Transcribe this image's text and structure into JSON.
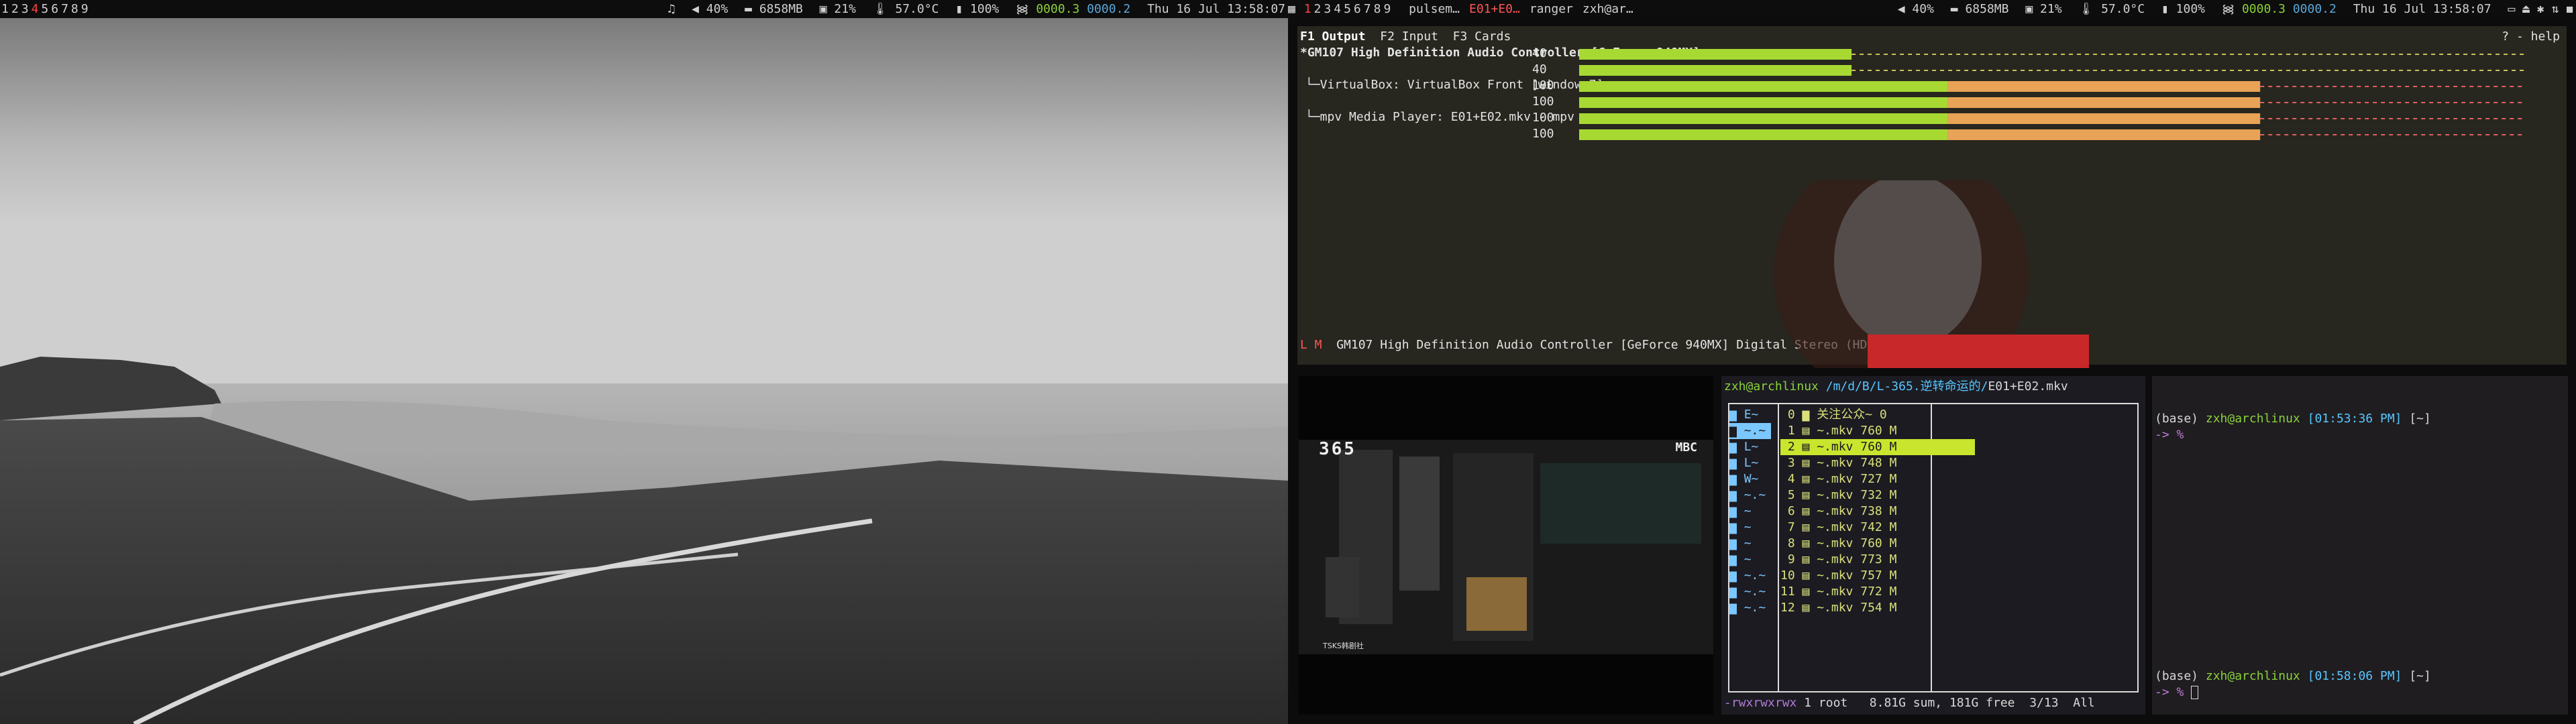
{
  "statusbar": {
    "left_workspaces": [
      "1",
      "2",
      "3",
      "4",
      "5",
      "6",
      "7",
      "8",
      "9"
    ],
    "left_active": "4",
    "right_workspaces": [
      "1",
      "2",
      "3",
      "4",
      "5",
      "6",
      "7",
      "8",
      "9"
    ],
    "right_active": "1",
    "right_windows": [
      {
        "title": "pulsem…",
        "active": false
      },
      {
        "title": "E01+E0…",
        "active": true
      },
      {
        "title": "ranger",
        "active": false
      },
      {
        "title": "zxh@ar…",
        "active": false
      }
    ],
    "volume": "40%",
    "memory": "6858MB",
    "cpu": "21%",
    "temp": "57.0°C",
    "battery": "100%",
    "net_down": "0000.3",
    "net_up": "0000.2",
    "datetime": "Thu 16 Jul 13:58:07"
  },
  "pavu": {
    "tabs": [
      "F1 Output",
      "F2 Input",
      "F3 Cards"
    ],
    "help": "? - help",
    "device": "*GM107 High Definition Audio Controller [GeForce 940MX]~",
    "streams": [
      "└─VirtualBox: VirtualBox Front [windows7]",
      "└─mpv Media Player: E01+E02.mkv - mpv"
    ],
    "levels": [
      {
        "value": "40",
        "fraction": 0.4
      },
      {
        "value": "40",
        "fraction": 0.4
      },
      {
        "value": "100",
        "fraction": 1.0
      },
      {
        "value": "100",
        "fraction": 1.0
      },
      {
        "value": "100",
        "fraction": 1.0
      },
      {
        "value": "100",
        "fraction": 1.0
      }
    ],
    "footer_flags": "L M",
    "footer_device": "GM107 High Definition Audio Controller [GeForce 940MX] Digital Stereo (HDMI): All"
  },
  "mpv": {
    "logo": "365",
    "channel": "MBC",
    "watermark": "TSKS韩剧社"
  },
  "ranger": {
    "user": "zxh@archlinux",
    "path": "/m/d/B/L-365.逆转命运的/",
    "file": "E01+E02.mkv",
    "parents": [
      "E~",
      "~.~",
      "L~",
      "L~",
      "W~",
      "~.~",
      "~",
      "~",
      "~",
      "~",
      "~.~",
      "~.~",
      "~.~"
    ],
    "parent_selected": 1,
    "files": [
      {
        "n": "0",
        "name": "关注公众~",
        "size": "0"
      },
      {
        "n": "1",
        "name": "~.mkv",
        "size": "760 M"
      },
      {
        "n": "2",
        "name": "~.mkv",
        "size": "760 M"
      },
      {
        "n": "3",
        "name": "~.mkv",
        "size": "748 M"
      },
      {
        "n": "4",
        "name": "~.mkv",
        "size": "727 M"
      },
      {
        "n": "5",
        "name": "~.mkv",
        "size": "732 M"
      },
      {
        "n": "6",
        "name": "~.mkv",
        "size": "738 M"
      },
      {
        "n": "7",
        "name": "~.mkv",
        "size": "742 M"
      },
      {
        "n": "8",
        "name": "~.mkv",
        "size": "760 M"
      },
      {
        "n": "9",
        "name": "~.mkv",
        "size": "773 M"
      },
      {
        "n": "10",
        "name": "~.mkv",
        "size": "757 M"
      },
      {
        "n": "11",
        "name": "~.mkv",
        "size": "772 M"
      },
      {
        "n": "12",
        "name": "~.mkv",
        "size": "754 M"
      }
    ],
    "selected": 2,
    "status_perm": "-rwxrwxrwx",
    "status_info": "1 root",
    "status_sum": "8.81G sum, 181G free",
    "status_pos": "3/13",
    "status_all": "All"
  },
  "terminal": {
    "prompts": [
      {
        "env": "(base)",
        "user": "zxh@archlinux",
        "time": "[01:53:36 PM]",
        "dir": "[~]",
        "arrow": "-> %"
      },
      {
        "env": "(base)",
        "user": "zxh@archlinux",
        "time": "[01:58:06 PM]",
        "dir": "[~]",
        "arrow": "-> %"
      }
    ]
  }
}
